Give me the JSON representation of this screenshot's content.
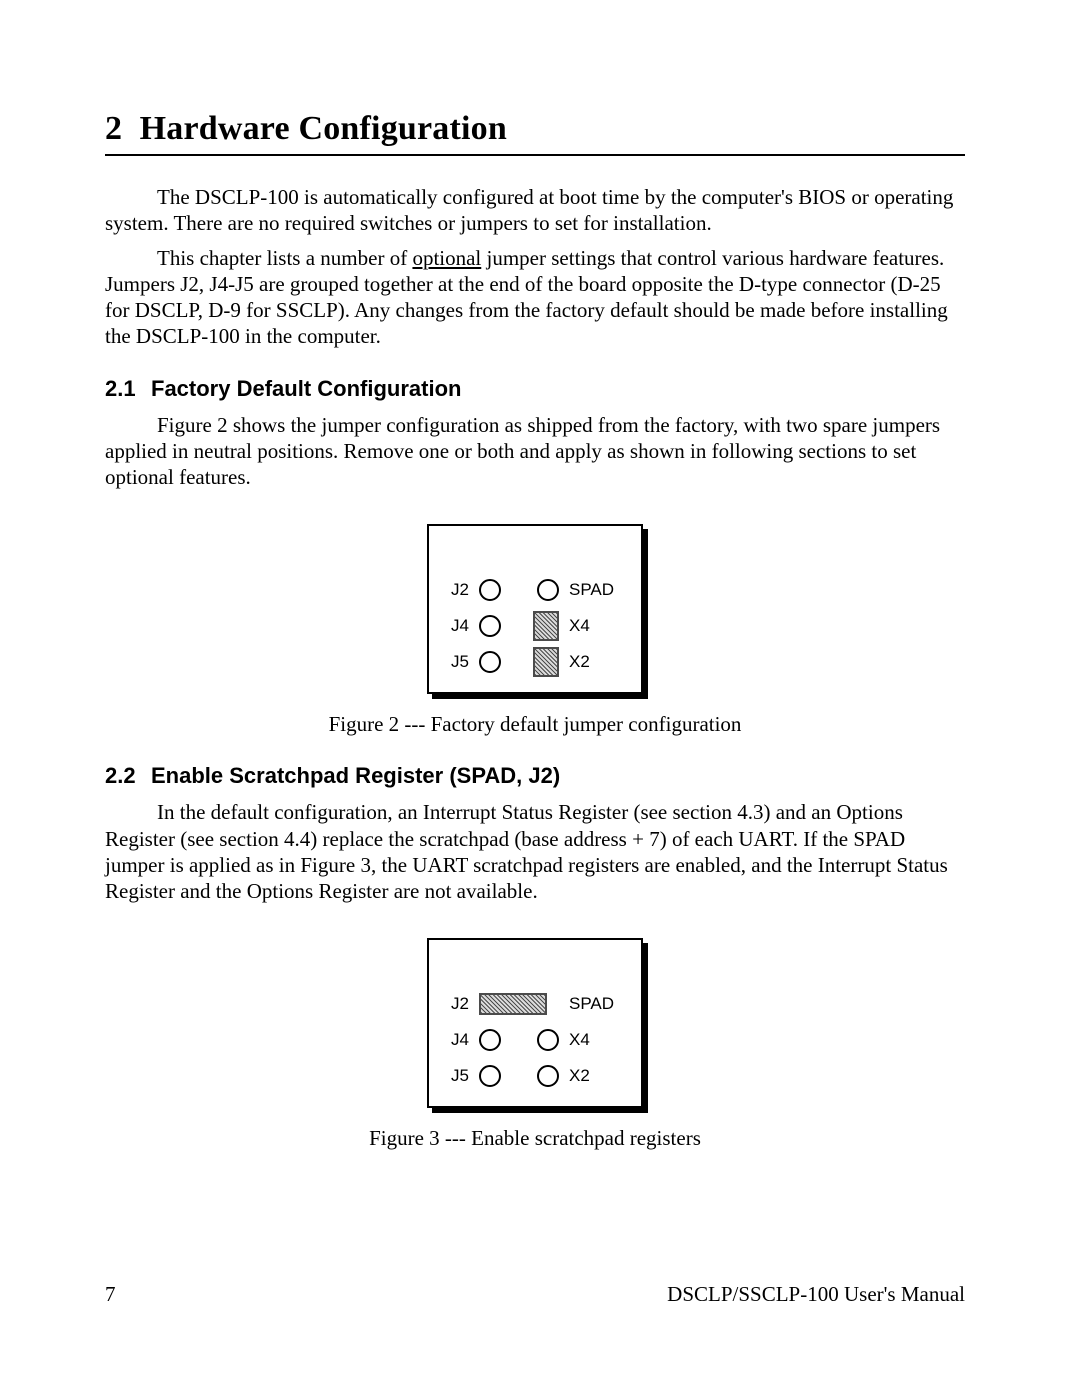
{
  "chapter": {
    "number": "2",
    "title": "Hardware Configuration"
  },
  "intro": {
    "p1_a": "The DSCLP-100 is automatically configured at boot time by the computer's BIOS or operating system.  There are no required switches or jumpers to set for installation.",
    "p2_lead": "This chapter lists a number of ",
    "p2_underline": "optional",
    "p2_tail": " jumper settings that control various hardware features.  Jumpers J2, J4-J5 are grouped together at the end of the board opposite the D-type connector (D-25 for DSCLP, D-9 for SSCLP).  Any changes from the factory default should be made before installing the DSCLP-100 in the computer."
  },
  "section21": {
    "num": "2.1",
    "title": "Factory Default Configuration",
    "p1": "Figure 2 shows the jumper configuration as shipped from the factory, with two spare jumpers applied in neutral positions.  Remove one or both and apply as shown in following sections to set optional features."
  },
  "figure2": {
    "rows": {
      "r1": {
        "left": "J2",
        "right": "SPAD"
      },
      "r2": {
        "left": "J4",
        "right": "X4"
      },
      "r3": {
        "left": "J5",
        "right": "X2"
      }
    },
    "caption": "Figure 2 --- Factory default jumper configuration"
  },
  "section22": {
    "num": "2.2",
    "title": "Enable Scratchpad Register (SPAD, J2)",
    "p1": "In the default configuration, an Interrupt Status Register (see section 4.3) and an Options Register (see section 4.4) replace the scratchpad (base address + 7) of each UART.   If the SPAD jumper is applied as in Figure 3, the UART scratchpad registers are enabled, and the Interrupt Status Register and the Options Register are not available."
  },
  "figure3": {
    "rows": {
      "r1": {
        "left": "J2",
        "right": "SPAD"
      },
      "r2": {
        "left": "J4",
        "right": "X4"
      },
      "r3": {
        "left": "J5",
        "right": "X2"
      }
    },
    "caption": "Figure 3 --- Enable scratchpad registers"
  },
  "footer": {
    "page": "7",
    "manual": "DSCLP/SSCLP-100 User's Manual"
  }
}
